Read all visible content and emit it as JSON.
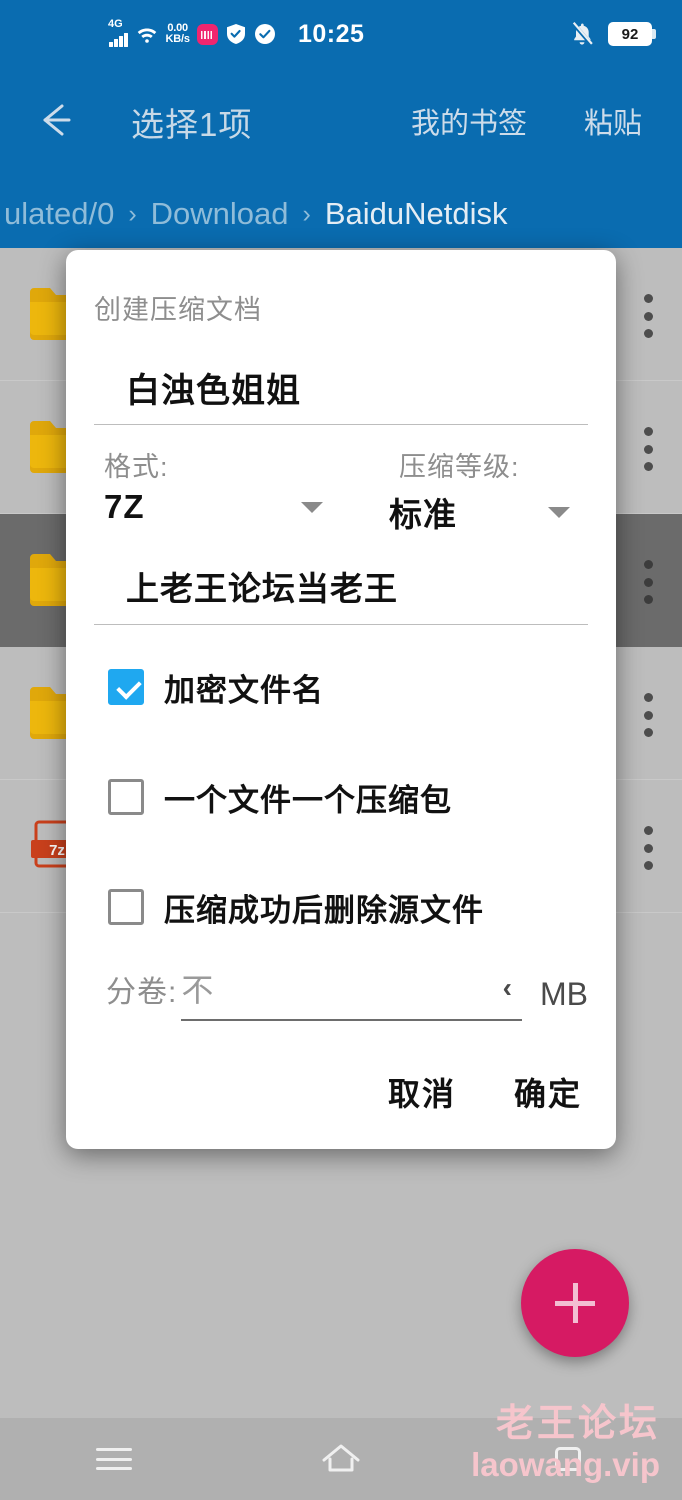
{
  "statusbar": {
    "network_type": "4G",
    "speed": "0.00",
    "speed_unit": "KB/s",
    "clock": "10:25",
    "battery": "92",
    "icons": [
      "signal-4g-icon",
      "wifi-icon",
      "network-speed",
      "app-badge-icon",
      "shield-check-icon",
      "circle-check-icon",
      "bell-muted-icon",
      "battery-icon"
    ]
  },
  "appbar": {
    "back_label": "back-arrow",
    "title": "选择1项",
    "action_bookmark": "我的书签",
    "action_paste": "粘贴"
  },
  "breadcrumb": {
    "separator": "›",
    "items": [
      {
        "label": "ulated/0",
        "active": false
      },
      {
        "label": "Download",
        "active": false
      },
      {
        "label": "BaiduNetdisk",
        "active": true
      }
    ]
  },
  "filelist": {
    "rows": [
      {
        "icon": "folder-icon",
        "selected": false
      },
      {
        "icon": "folder-icon",
        "selected": false
      },
      {
        "icon": "folder-icon",
        "selected": true
      },
      {
        "icon": "folder-icon",
        "selected": false
      },
      {
        "icon": "archive-icon",
        "selected": false
      }
    ]
  },
  "dialog": {
    "title": "创建压缩文档",
    "archive_name": "白浊色姐姐",
    "format": {
      "label": "格式:",
      "value": "7Z"
    },
    "level": {
      "label": "压缩等级:",
      "value": "标准"
    },
    "password": "上老王论坛当老王",
    "checkboxes": [
      {
        "label": "加密文件名",
        "checked": true
      },
      {
        "label": "一个文件一个压缩包",
        "checked": false
      },
      {
        "label": "压缩成功后删除源文件",
        "checked": false
      }
    ],
    "split": {
      "label": "分卷:",
      "value": "不",
      "chevron": "‹",
      "unit": "MB"
    },
    "cancel_label": "取消",
    "confirm_label": "确定"
  },
  "fab": {
    "label": "add-icon"
  },
  "watermark": {
    "line1": "老王论坛",
    "line2": "laowang.vip",
    "color": "#f6c5cc"
  },
  "navbar": {
    "menu": "menu-icon",
    "home": "home-icon",
    "recents": "recents-icon"
  },
  "colors": {
    "header_blue": "#0a6cb0",
    "accent_checkbox": "#1fa8f0",
    "fab_pink": "#d61a63",
    "folder_yellow": "#e0a80b",
    "archive_red": "#c9401c"
  }
}
